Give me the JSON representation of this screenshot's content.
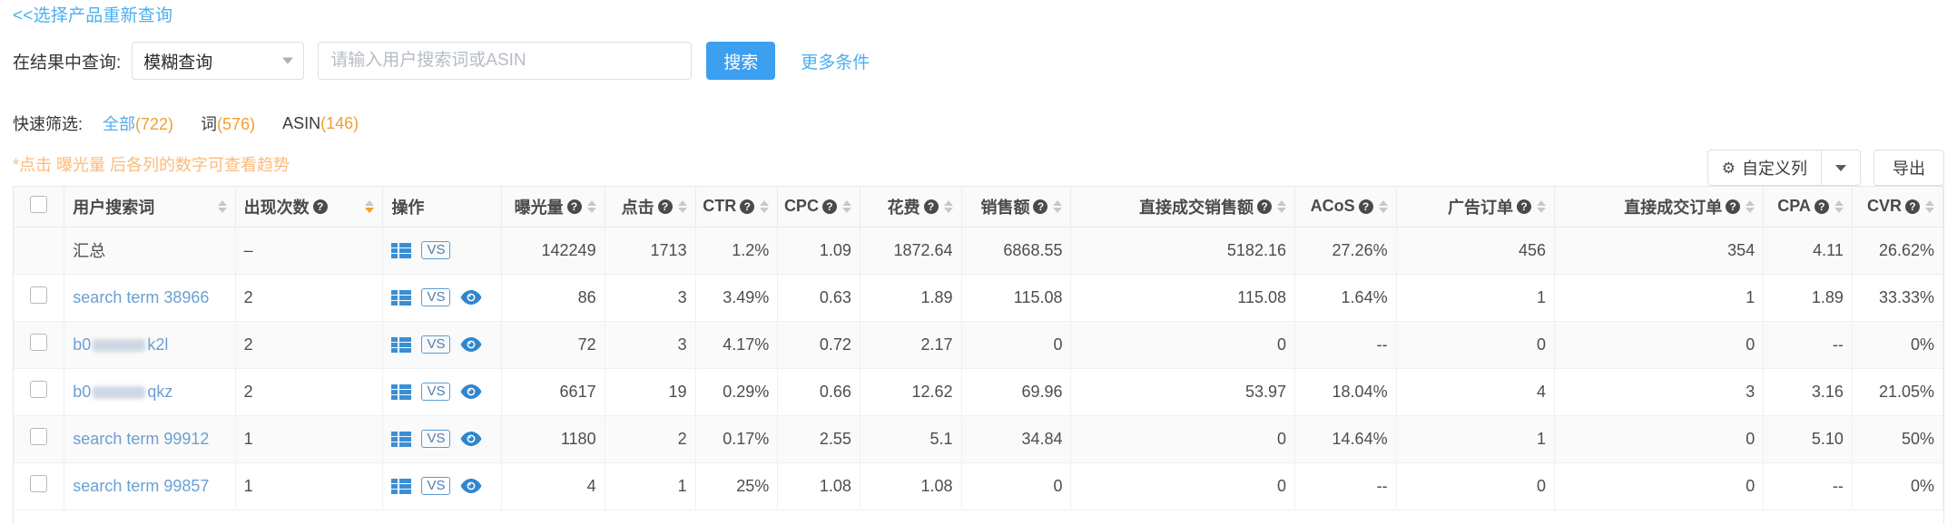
{
  "back_link": "<<选择产品重新查询",
  "query": {
    "label": "在结果中查询:",
    "match_mode": "模糊查询",
    "input_value": "",
    "input_placeholder": "请输入用户搜索词或ASIN",
    "search_button": "搜索",
    "more_conditions": "更多条件"
  },
  "quick_filter": {
    "label": "快速筛选:",
    "items": [
      {
        "name": "全部",
        "count": "(722)",
        "active": true
      },
      {
        "name": "词",
        "count": "(576)",
        "active": false
      },
      {
        "name": "ASIN",
        "count": "(146)",
        "active": false
      }
    ]
  },
  "note": "*点击 曝光量 后各列的数字可查看趋势",
  "actions": {
    "custom_columns": "自定义列",
    "export": "导出",
    "gear_icon": "gear-icon",
    "caret_icon": "chevron-down-icon"
  },
  "colors": {
    "accent": "#3c9ff0",
    "link": "#4ab0ef",
    "count_orange": "#f0a030",
    "note_orange": "#fbbb7c",
    "term_link": "#6b9fd4",
    "icon_blue": "#3a8fd4"
  },
  "table": {
    "columns": [
      {
        "key": "checkbox",
        "label": "",
        "help": false,
        "sort": "none",
        "align": "center"
      },
      {
        "key": "term",
        "label": "用户搜索词",
        "help": false,
        "sort": "both",
        "align": "left"
      },
      {
        "key": "occurrences",
        "label": "出现次数",
        "help": true,
        "sort": "desc",
        "align": "left"
      },
      {
        "key": "operations",
        "label": "操作",
        "help": false,
        "sort": "none",
        "align": "left"
      },
      {
        "key": "impressions",
        "label": "曝光量",
        "help": true,
        "sort": "both",
        "align": "right"
      },
      {
        "key": "clicks",
        "label": "点击",
        "help": true,
        "sort": "both",
        "align": "right"
      },
      {
        "key": "ctr",
        "label": "CTR",
        "help": true,
        "sort": "both",
        "align": "right"
      },
      {
        "key": "cpc",
        "label": "CPC",
        "help": true,
        "sort": "both",
        "align": "right"
      },
      {
        "key": "cost",
        "label": "花费",
        "help": true,
        "sort": "both",
        "align": "right"
      },
      {
        "key": "sales",
        "label": "销售额",
        "help": true,
        "sort": "both",
        "align": "right"
      },
      {
        "key": "direct_sales",
        "label": "直接成交销售额",
        "help": true,
        "sort": "both",
        "align": "right"
      },
      {
        "key": "acos",
        "label": "ACoS",
        "help": true,
        "sort": "both",
        "align": "right"
      },
      {
        "key": "ad_orders",
        "label": "广告订单",
        "help": true,
        "sort": "both",
        "align": "right"
      },
      {
        "key": "direct_orders",
        "label": "直接成交订单",
        "help": true,
        "sort": "both",
        "align": "right"
      },
      {
        "key": "cpa",
        "label": "CPA",
        "help": true,
        "sort": "both",
        "align": "right"
      },
      {
        "key": "cvr",
        "label": "CVR",
        "help": true,
        "sort": "both",
        "align": "right"
      }
    ],
    "total_row": {
      "term": "汇总",
      "occurrences": "–",
      "impressions": "142249",
      "clicks": "1713",
      "ctr": "1.2%",
      "cpc": "1.09",
      "cost": "1872.64",
      "sales": "6868.55",
      "direct_sales": "5182.16",
      "acos": "27.26%",
      "ad_orders": "456",
      "direct_orders": "354",
      "cpa": "4.11",
      "cvr": "26.62%"
    },
    "rows": [
      {
        "term": "search term 38966",
        "redacted": false,
        "occurrences": "2",
        "impressions": "86",
        "clicks": "3",
        "ctr": "3.49%",
        "cpc": "0.63",
        "cost": "1.89",
        "sales": "115.08",
        "direct_sales": "115.08",
        "acos": "1.64%",
        "ad_orders": "1",
        "direct_orders": "1",
        "cpa": "1.89",
        "cvr": "33.33%"
      },
      {
        "term_prefix": "b0",
        "term_suffix": "k2l",
        "redacted": true,
        "occurrences": "2",
        "impressions": "72",
        "clicks": "3",
        "ctr": "4.17%",
        "cpc": "0.72",
        "cost": "2.17",
        "sales": "0",
        "direct_sales": "0",
        "acos": "--",
        "ad_orders": "0",
        "direct_orders": "0",
        "cpa": "--",
        "cvr": "0%"
      },
      {
        "term_prefix": "b0",
        "term_suffix": "qkz",
        "redacted": true,
        "occurrences": "2",
        "impressions": "6617",
        "clicks": "19",
        "ctr": "0.29%",
        "cpc": "0.66",
        "cost": "12.62",
        "sales": "69.96",
        "direct_sales": "53.97",
        "acos": "18.04%",
        "ad_orders": "4",
        "direct_orders": "3",
        "cpa": "3.16",
        "cvr": "21.05%"
      },
      {
        "term": "search term 99912",
        "redacted": false,
        "occurrences": "1",
        "impressions": "1180",
        "clicks": "2",
        "ctr": "0.17%",
        "cpc": "2.55",
        "cost": "5.1",
        "sales": "34.84",
        "direct_sales": "0",
        "acos": "14.64%",
        "ad_orders": "1",
        "direct_orders": "0",
        "cpa": "5.10",
        "cvr": "50%"
      },
      {
        "term": "search term 99857",
        "redacted": false,
        "occurrences": "1",
        "impressions": "4",
        "clicks": "1",
        "ctr": "25%",
        "cpc": "1.08",
        "cost": "1.08",
        "sales": "0",
        "direct_sales": "0",
        "acos": "--",
        "ad_orders": "0",
        "direct_orders": "0",
        "cpa": "--",
        "cvr": "0%"
      }
    ],
    "row_icons": {
      "list_icon": "list-icon",
      "vs_label": "VS",
      "eye_icon": "eye-icon"
    }
  }
}
